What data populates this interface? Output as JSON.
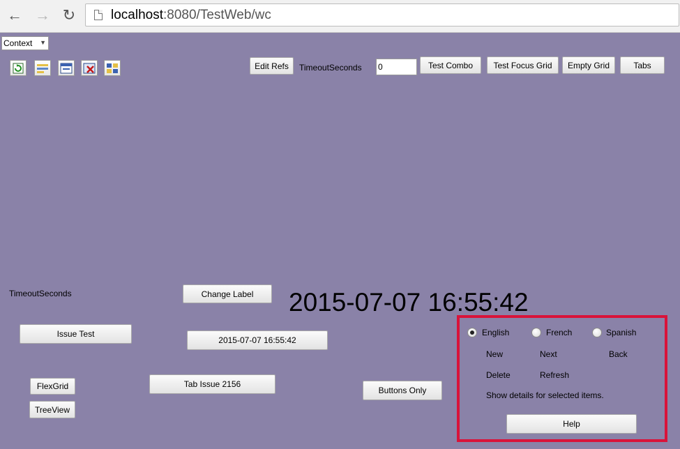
{
  "browser": {
    "url_host": "localhost",
    "url_rest": ":8080/TestWeb/wc"
  },
  "toolbar": {
    "context_label": "Context",
    "edit_refs": "Edit Refs",
    "timeout_label": "TimeoutSeconds",
    "timeout_value": "0",
    "test_combo": "Test Combo",
    "test_focus_grid": "Test Focus Grid",
    "empty_grid": "Empty Grid",
    "tabs": "Tabs"
  },
  "main": {
    "timeout_label": "TimeoutSeconds",
    "change_label": "Change Label",
    "clock": "2015-07-07 16:55:42",
    "issue_test": "Issue Test",
    "date_button": "2015-07-07 16:55:42",
    "tab_issue": "Tab Issue 2156",
    "buttons_only": "Buttons Only",
    "flexgrid": "FlexGrid",
    "treeview": "TreeView"
  },
  "panel": {
    "lang_english": "English",
    "lang_french": "French",
    "lang_spanish": "Spanish",
    "selected_language": "English",
    "new": "New",
    "next": "Next",
    "back": "Back",
    "delete": "Delete",
    "refresh": "Refresh",
    "details_text": "Show details for selected items.",
    "help": "Help"
  },
  "colors": {
    "background": "#8a82a8",
    "panel_border": "#d9133a"
  }
}
